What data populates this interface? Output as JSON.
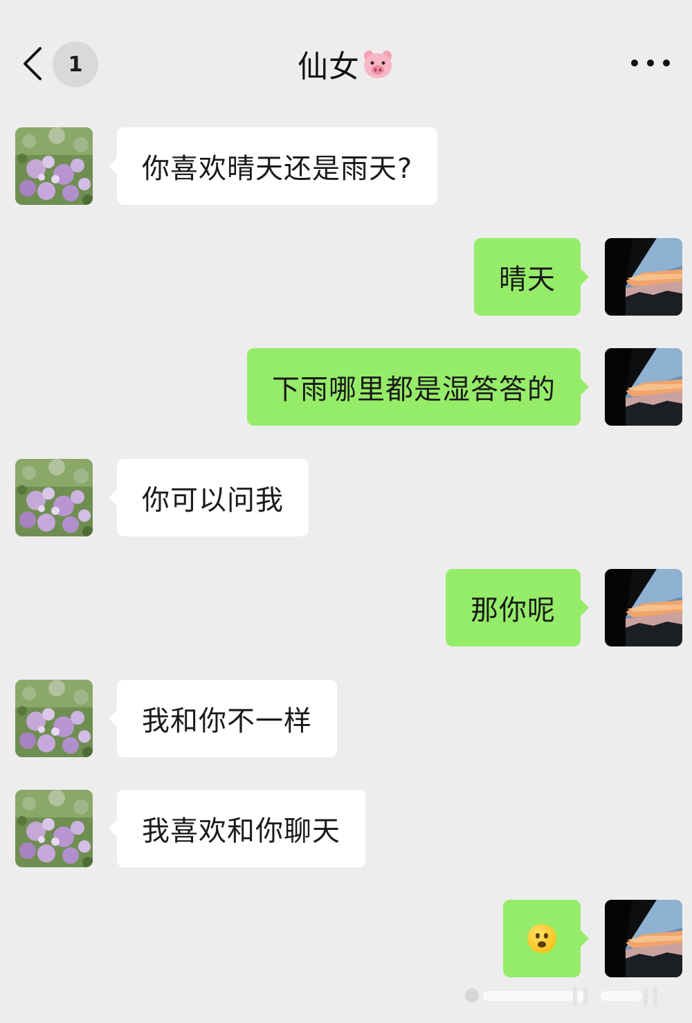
{
  "header": {
    "unread_count": "1",
    "title": "仙女"
  },
  "messages": [
    {
      "side": "left",
      "text": "你喜欢晴天还是雨天?"
    },
    {
      "side": "right",
      "text": "晴天"
    },
    {
      "side": "right",
      "text": "下雨哪里都是湿答答的"
    },
    {
      "side": "left",
      "text": "你可以问我"
    },
    {
      "side": "right",
      "text": "那你呢"
    },
    {
      "side": "left",
      "text": "我和你不一样"
    },
    {
      "side": "left",
      "text": "我喜欢和你聊天"
    },
    {
      "side": "right",
      "text": "",
      "emoji": "hushed-face"
    }
  ],
  "colors": {
    "background": "#ededed",
    "incoming_bubble": "#ffffff",
    "outgoing_bubble": "#95ec69"
  },
  "icons": {
    "back": "chevron-left-icon",
    "more": "more-dots-icon",
    "title_emoji": "pig-face-icon"
  }
}
